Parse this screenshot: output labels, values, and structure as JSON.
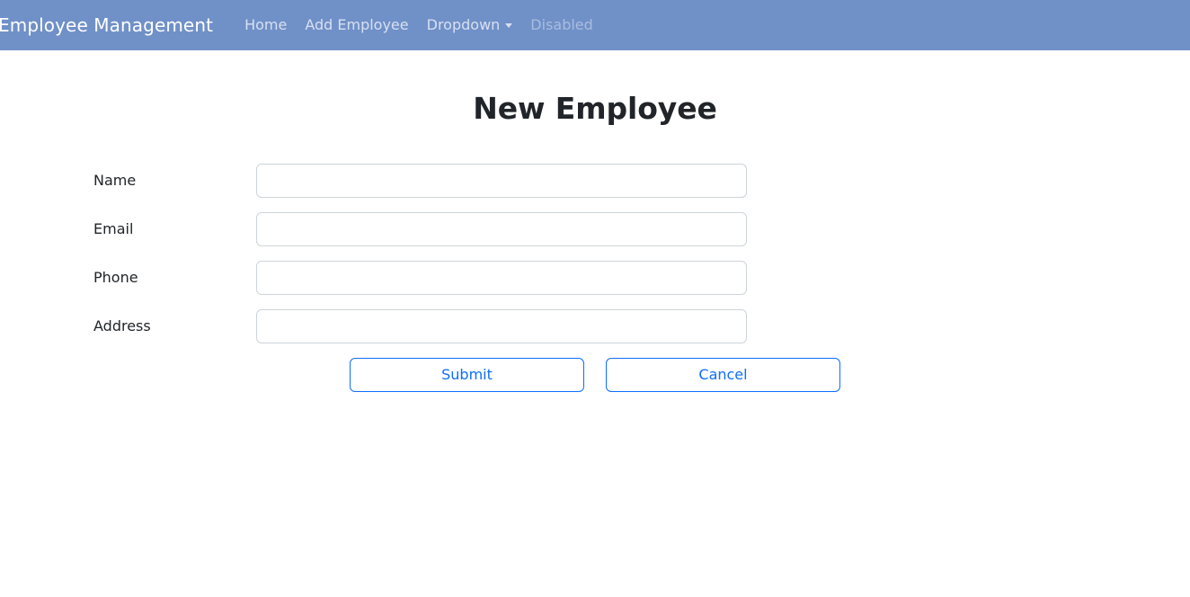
{
  "navbar": {
    "brand": "Employee Management",
    "links": [
      {
        "label": "Home",
        "state": "normal"
      },
      {
        "label": "Add Employee",
        "state": "normal"
      },
      {
        "label": "Dropdown",
        "state": "dropdown"
      },
      {
        "label": "Disabled",
        "state": "disabled"
      }
    ],
    "background_color": "#7090c8",
    "brand_color": "#ffffff"
  },
  "main": {
    "title": "New Employee",
    "form": {
      "fields": [
        {
          "label": "Name",
          "value": "",
          "placeholder": ""
        },
        {
          "label": "Email",
          "value": "",
          "placeholder": ""
        },
        {
          "label": "Phone",
          "value": "",
          "placeholder": ""
        },
        {
          "label": "Address",
          "value": "",
          "placeholder": ""
        }
      ],
      "buttons": {
        "submit": "Submit",
        "cancel": "Cancel",
        "accent_color": "#0d6efd"
      }
    }
  }
}
